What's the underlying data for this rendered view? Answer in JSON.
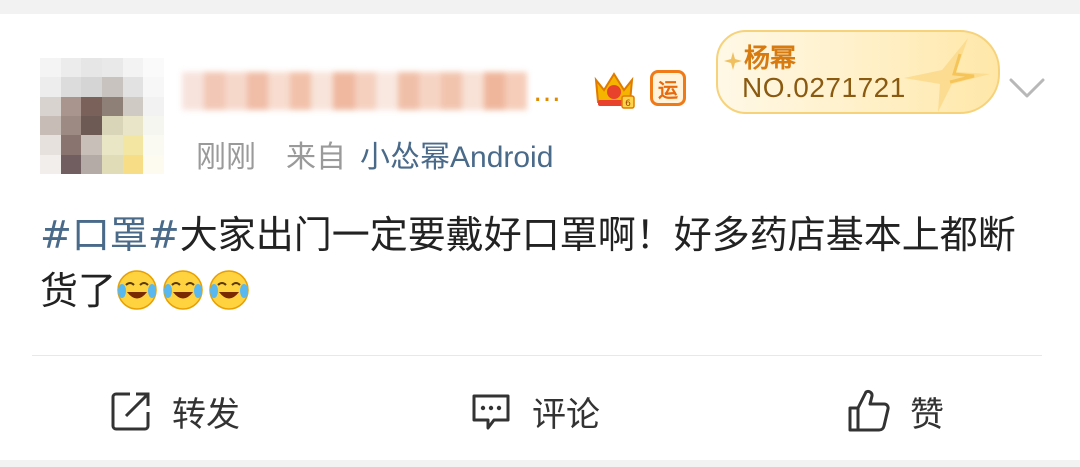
{
  "post": {
    "username_suffix": "…",
    "timestamp": "刚刚",
    "source_prefix": "来自",
    "source": "小怂幂Android",
    "text_topic": "#口罩#",
    "text_body": "大家出门一定要戴好口罩啊！好多药店基本上都断货了"
  },
  "badges": {
    "yun_label": "运",
    "fan_name": "杨幂",
    "fan_number": "NO.0271721"
  },
  "actions": {
    "repost_label": "转发",
    "comment_label": "评论",
    "like_label": "赞"
  },
  "icons": [
    "crown-icon",
    "yun-badge-icon",
    "star-icon",
    "sparkle-icon",
    "chevron-down-icon",
    "laugh-cry-emoji",
    "repost-icon",
    "comment-icon",
    "like-icon"
  ],
  "colors": {
    "link_blue": "#4a6a8a",
    "badge_orange": "#d77a10",
    "meta_gray": "#9a9a9a",
    "text": "#222222"
  }
}
